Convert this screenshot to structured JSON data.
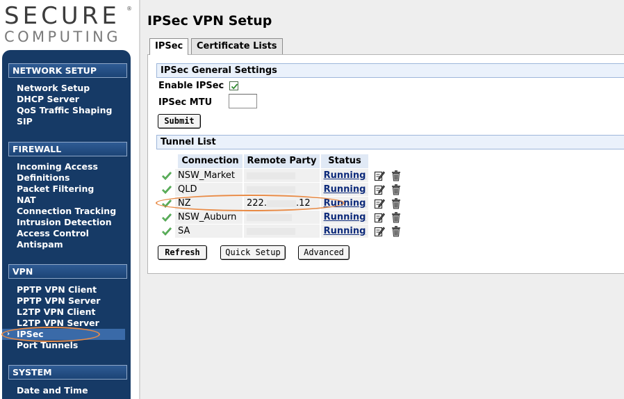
{
  "logo": {
    "line1": "SECURE",
    "line2": "COMPUTING",
    "registered": "®"
  },
  "sidebar": {
    "sections": [
      {
        "title": "NETWORK SETUP",
        "items": [
          "Network Setup",
          "DHCP Server",
          "QoS Traffic Shaping",
          "SIP"
        ]
      },
      {
        "title": "FIREWALL",
        "items": [
          "Incoming Access",
          "Definitions",
          "Packet Filtering",
          "NAT",
          "Connection Tracking",
          "Intrusion Detection",
          "Access Control",
          "Antispam"
        ]
      },
      {
        "title": "VPN",
        "items": [
          "PPTP VPN Client",
          "PPTP VPN Server",
          "L2TP VPN Client",
          "L2TP VPN Server",
          "IPSec",
          "Port Tunnels"
        ]
      },
      {
        "title": "SYSTEM",
        "items": [
          "Date and Time"
        ]
      }
    ],
    "active_item": "IPSec",
    "active_arrow": "›"
  },
  "page": {
    "title": "IPSec VPN Setup"
  },
  "tabs": [
    "IPSec",
    "Certificate Lists"
  ],
  "general": {
    "heading": "IPSec General Settings",
    "enable_label": "Enable IPSec",
    "enable_checked": true,
    "mtu_label": "IPSec MTU",
    "mtu_value": "",
    "submit_label": "Submit"
  },
  "tunnels": {
    "heading": "Tunnel List",
    "columns": [
      "Connection",
      "Remote Party",
      "Status"
    ],
    "rows": [
      {
        "connection": "NSW_Market",
        "remote": "",
        "status": "Running"
      },
      {
        "connection": "QLD",
        "remote": "",
        "status": "Running"
      },
      {
        "connection": "NZ",
        "remote": "222.",
        "remote_tail": ".12",
        "status": "Running"
      },
      {
        "connection": "NSW_Auburn",
        "remote": "",
        "status": "Running"
      },
      {
        "connection": "SA",
        "remote": "",
        "status": "Running"
      }
    ],
    "row_icons": [
      "check-icon",
      "edit-icon",
      "trash-icon"
    ]
  },
  "buttons": {
    "refresh": "Refresh",
    "quick_setup": "Quick Setup",
    "advanced": "Advanced"
  },
  "colors": {
    "sidebar": "#163a66",
    "link": "#0d2a7a",
    "annotation": "#e88a45",
    "check": "#2e8b2e"
  }
}
